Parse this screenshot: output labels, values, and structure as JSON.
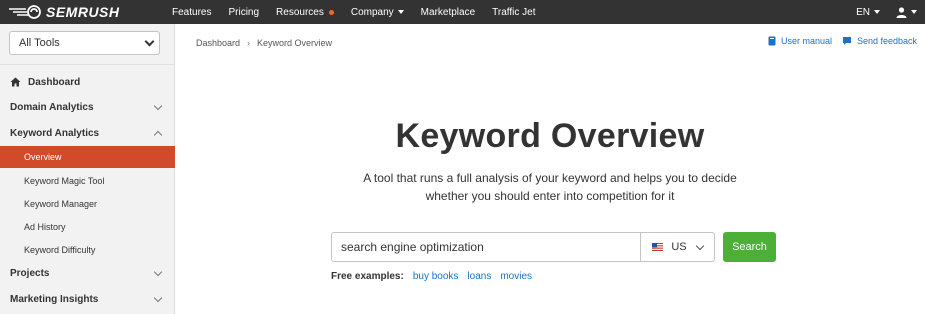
{
  "topbar": {
    "logo_text": "SEMRUSH",
    "nav": [
      {
        "label": "Features"
      },
      {
        "label": "Pricing"
      },
      {
        "label": "Resources"
      },
      {
        "label": "Company"
      },
      {
        "label": "Marketplace"
      },
      {
        "label": "Traffic Jet"
      }
    ],
    "language": "EN",
    "colors": {
      "background": "#333333",
      "accent_dot": "#ff642d"
    }
  },
  "sidebar": {
    "tools_select": "All Tools",
    "items": [
      {
        "label": "Dashboard",
        "type": "section",
        "icon": "home-icon"
      },
      {
        "label": "Domain Analytics",
        "type": "section",
        "expanded": false
      },
      {
        "label": "Keyword Analytics",
        "type": "section",
        "expanded": true
      },
      {
        "label": "Overview",
        "type": "sub",
        "active": true
      },
      {
        "label": "Keyword Magic Tool",
        "type": "sub"
      },
      {
        "label": "Keyword Manager",
        "type": "sub"
      },
      {
        "label": "Ad History",
        "type": "sub"
      },
      {
        "label": "Keyword Difficulty",
        "type": "sub"
      },
      {
        "label": "Projects",
        "type": "section",
        "expanded": false
      },
      {
        "label": "Marketing Insights",
        "type": "section",
        "expanded": false
      }
    ],
    "colors": {
      "active": "#d14a2a",
      "background": "#f2f2f2"
    }
  },
  "breadcrumb": [
    "Dashboard",
    "Keyword Overview"
  ],
  "helpers": {
    "user_manual": "User manual",
    "send_feedback": "Send feedback"
  },
  "main": {
    "title": "Keyword Overview",
    "description_line1": "A tool that runs a full analysis of your keyword and helps you to decide",
    "description_line2": "whether you should enter into competition for it",
    "search_value": "search engine optimization",
    "database": "US",
    "search_button": "Search",
    "examples_label": "Free examples:",
    "examples": [
      "buy books",
      "loans",
      "movies"
    ],
    "colors": {
      "search_button": "#4caf36",
      "link": "#1a73c7"
    }
  }
}
